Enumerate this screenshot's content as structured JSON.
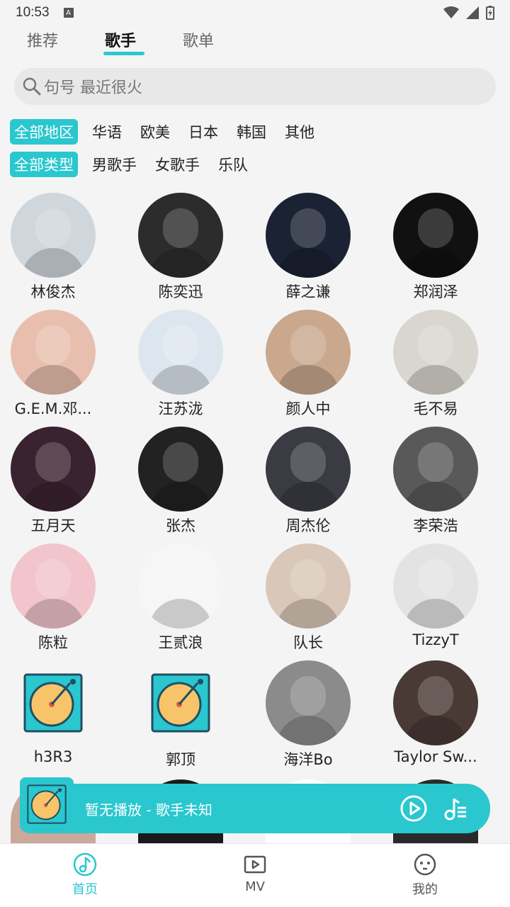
{
  "status": {
    "time": "10:53"
  },
  "tabs": [
    {
      "label": "推荐"
    },
    {
      "label": "歌手"
    },
    {
      "label": "歌单"
    }
  ],
  "search": {
    "placeholder": "句号 最近很火"
  },
  "filters": {
    "region": [
      "全部地区",
      "华语",
      "欧美",
      "日本",
      "韩国",
      "其他"
    ],
    "type": [
      "全部类型",
      "男歌手",
      "女歌手",
      "乐队"
    ]
  },
  "artists": [
    {
      "name": "林俊杰",
      "color": "#cfd6dc"
    },
    {
      "name": "陈奕迅",
      "color": "#2c2c2c"
    },
    {
      "name": "薛之谦",
      "color": "#1b2233"
    },
    {
      "name": "郑润泽",
      "color": "#111111"
    },
    {
      "name": "G.E.M.邓...",
      "color": "#e8bfae"
    },
    {
      "name": "汪苏泷",
      "color": "#dde6ee"
    },
    {
      "name": "颜人中",
      "color": "#c9a88e"
    },
    {
      "name": "毛不易",
      "color": "#d9d6cf"
    },
    {
      "name": "五月天",
      "color": "#3a2330"
    },
    {
      "name": "张杰",
      "color": "#222222"
    },
    {
      "name": "周杰伦",
      "color": "#3b3b44"
    },
    {
      "name": "李荣浩",
      "color": "#595959"
    },
    {
      "name": "陈粒",
      "color": "#f2c4cc"
    },
    {
      "name": "王贰浪",
      "color": "#f6f6f6"
    },
    {
      "name": "队长",
      "color": "#d9c7b9"
    },
    {
      "name": "TizzyT",
      "color": "#e3e3e3"
    },
    {
      "name": "h3R3",
      "color": "turntable"
    },
    {
      "name": "郭顶",
      "color": "turntable"
    },
    {
      "name": "海洋Bo",
      "color": "#8b8b8b"
    },
    {
      "name": "Taylor Sw...",
      "color": "#4a3a35"
    }
  ],
  "player": {
    "title": "暂无播放 - 歌手未知"
  },
  "nav": [
    {
      "label": "首页"
    },
    {
      "label": "MV"
    },
    {
      "label": "我的"
    }
  ],
  "colors": {
    "accent": "#2ac7cf"
  }
}
